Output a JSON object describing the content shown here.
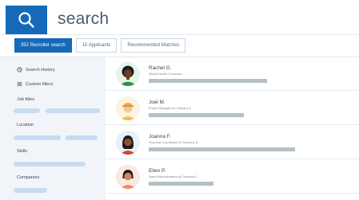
{
  "search": {
    "text": "search"
  },
  "tabs": [
    {
      "label": "352 Recruiter search",
      "active": true
    },
    {
      "label": "15 Applicants",
      "active": false
    },
    {
      "label": "Recommended Matches",
      "active": false
    }
  ],
  "sidebar": {
    "links": [
      {
        "label": "Search History",
        "icon": "history-icon"
      },
      {
        "label": "Custom filters",
        "icon": "filter-lines-icon"
      }
    ],
    "sections": [
      "Job titles",
      "Location",
      "Skills",
      "Companies"
    ]
  },
  "results": [
    {
      "name": "Rachel G.",
      "role": "Mental Health Counselor",
      "avatar": "avatar-rachel"
    },
    {
      "name": "Joel M.",
      "role": "Project Manager at Company A",
      "avatar": "avatar-joel"
    },
    {
      "name": "Joanna F.",
      "role": "Financial Coordinator at Company B",
      "avatar": "avatar-joanna"
    },
    {
      "name": "Ellen P.",
      "role": "Sales Representative at Company C",
      "avatar": "avatar-ellen"
    }
  ],
  "colors": {
    "primary": "#1669b8",
    "sidebar_bg": "#f1f5f9",
    "pill": "#c8dbf0",
    "text_bar": "#b4c0c6"
  }
}
